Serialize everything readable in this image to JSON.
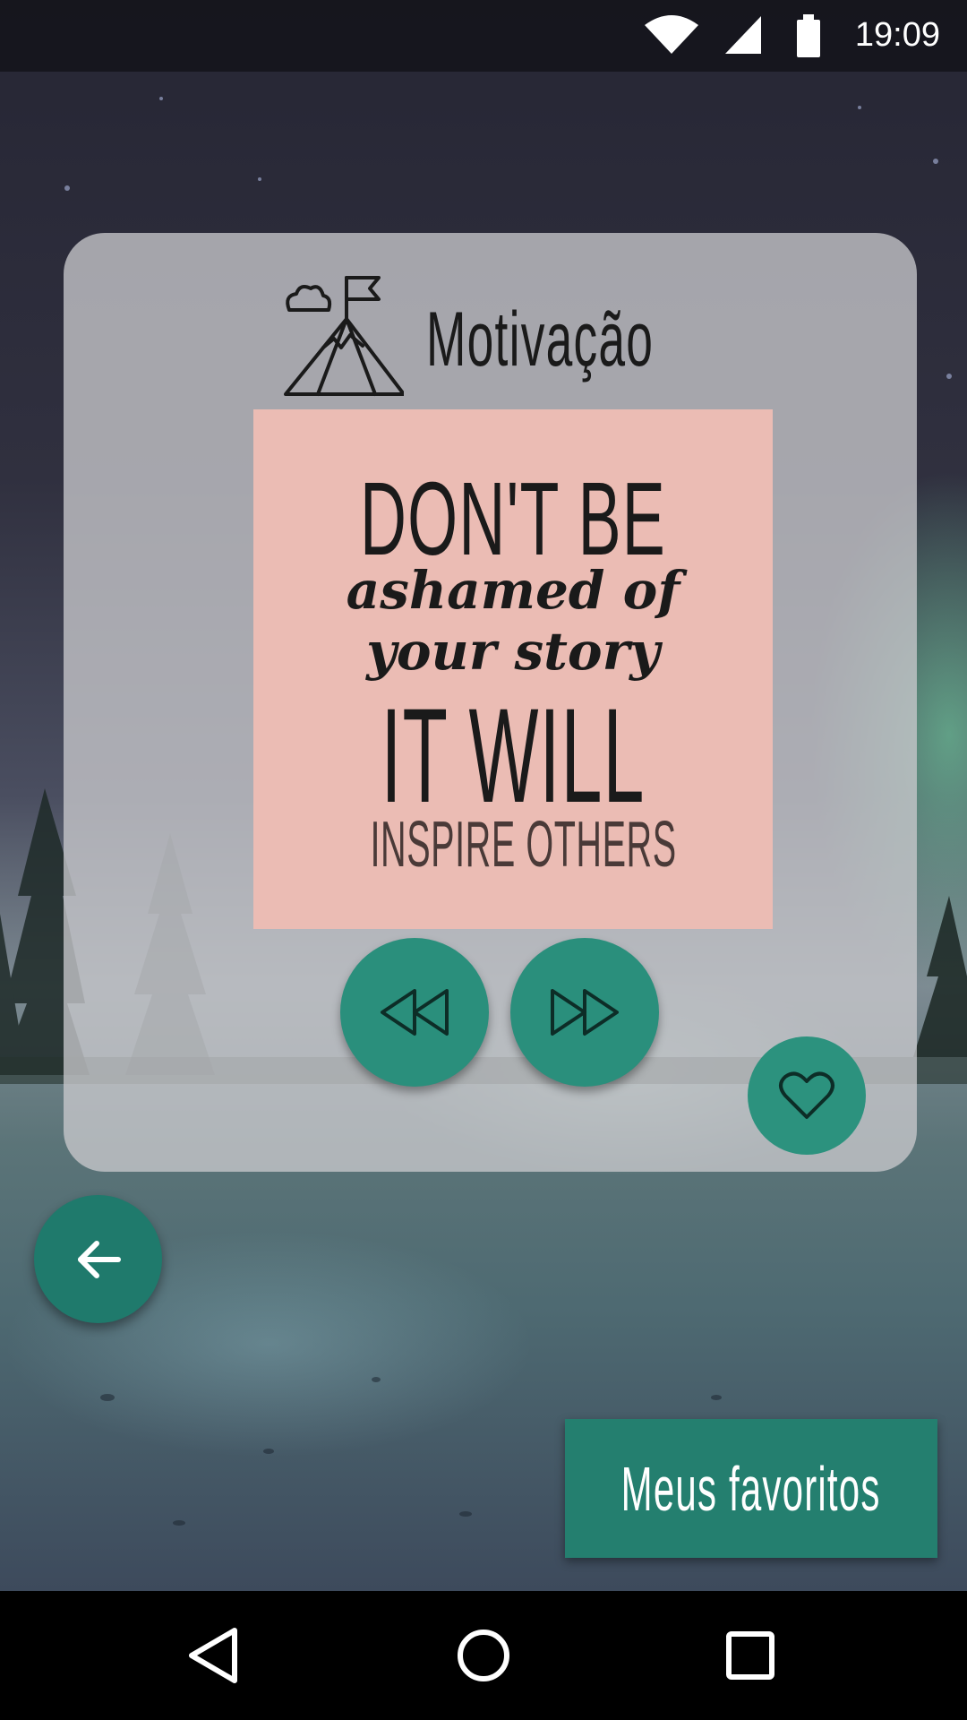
{
  "status_bar": {
    "time": "19:09",
    "icons": [
      "wifi-icon",
      "cell-signal-icon",
      "battery-icon"
    ]
  },
  "card": {
    "title": "Motivação",
    "header_icon": "mountain-flag-icon",
    "quote": {
      "line1": "DON'T BE",
      "line2": "ashamed of",
      "line3": "your story",
      "line4": "IT WILL",
      "line5": "INSPIRE OTHERS"
    },
    "controls": {
      "rewind_icon": "rewind-icon",
      "forward_icon": "fast-forward-icon",
      "favorite_icon": "heart-icon"
    }
  },
  "back_fab": {
    "icon": "arrow-left-icon"
  },
  "favorites_button": {
    "label": "Meus favoritos"
  },
  "nav_bar": {
    "icons": [
      "nav-back-icon",
      "nav-home-icon",
      "nav-recents-icon"
    ]
  },
  "colors": {
    "accent": "#2a8f7c",
    "quote_background": "#ebbcb4",
    "card_background": "#c8c8cc"
  }
}
